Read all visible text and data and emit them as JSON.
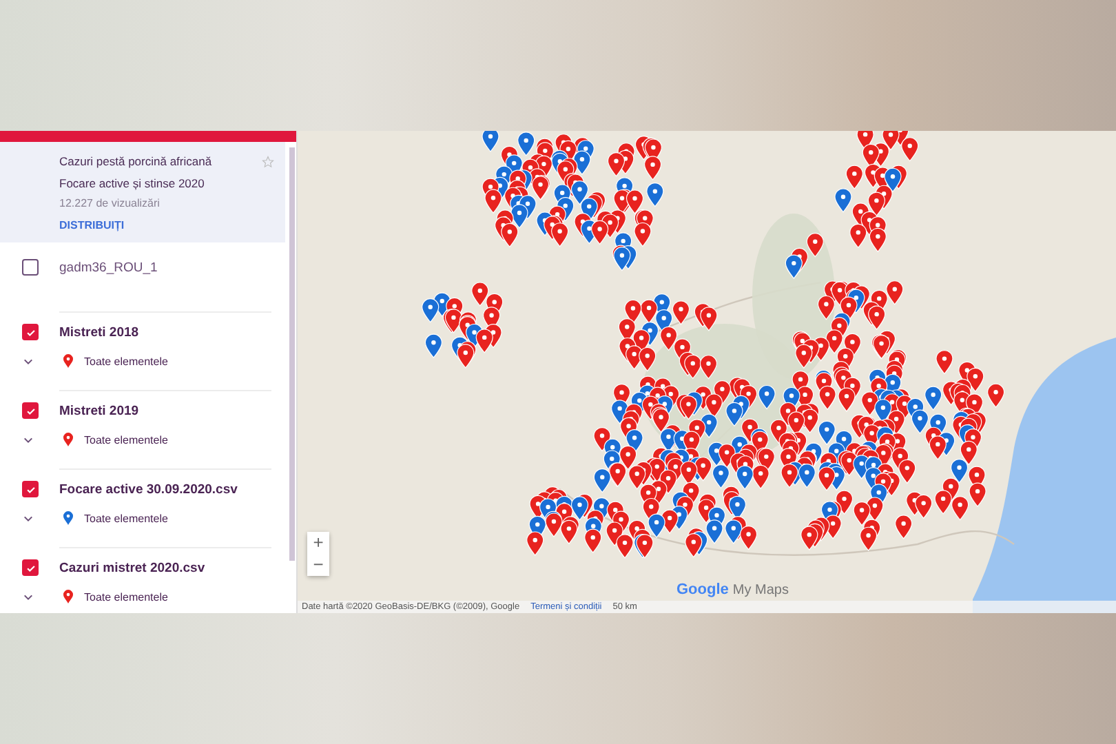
{
  "map_header": {
    "title_lines": [
      "Cazuri pestă porcină africană",
      "Focare active și stinse 2020"
    ],
    "views": "12.227 de vizualizări",
    "share_link": "DISTRIBUIȚI",
    "starred": false
  },
  "layers": [
    {
      "kind": "plain",
      "name": "gadm36_ROU_1",
      "checked": false
    },
    {
      "kind": "points",
      "name": "Mistreti 2018",
      "checked": true,
      "style_label": "Toate elementele",
      "color": "#e8231f"
    },
    {
      "kind": "points",
      "name": "Mistreti 2019",
      "checked": true,
      "style_label": "Toate elementele",
      "color": "#e8231f"
    },
    {
      "kind": "points",
      "name": "Focare active 30.09.2020.csv",
      "checked": true,
      "style_label": "Toate elementele",
      "color": "#1a6fd6"
    },
    {
      "kind": "points",
      "name": "Cazuri mistret 2020.csv",
      "checked": true,
      "style_label": "Toate elementele",
      "color": "#e8231f"
    }
  ],
  "map": {
    "zoom_in": "+",
    "zoom_out": "−",
    "attribution": "Date hartă ©2020 GeoBasis-DE/BKG (©2009), Google",
    "terms_link": "Termeni și condiții",
    "scale": "50 km",
    "brand": "Google",
    "brand_product": "My Maps"
  }
}
